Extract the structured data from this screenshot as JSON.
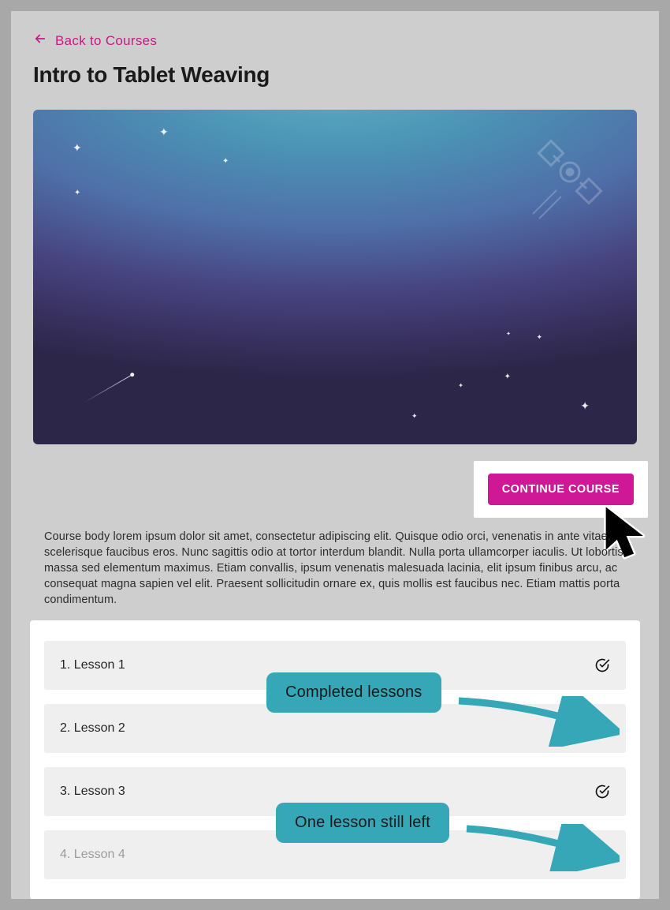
{
  "nav": {
    "back_label": "Back to Courses"
  },
  "course": {
    "title": "Intro to Tablet Weaving",
    "cta_label": "CONTINUE COURSE",
    "body": "Course body lorem ipsum dolor sit amet, consectetur adipiscing elit. Quisque odio orci, venenatis in ante vitae, scelerisque faucibus eros. Nunc sagittis odio at tortor interdum blandit. Nulla porta ullamcorper iaculis. Ut lobortis massa sed elementum maximus. Etiam convallis, ipsum venenatis malesuada lacinia, elit ipsum finibus arcu, ac consequat magna sapien vel elit. Praesent sollicitudin ornare ex, quis mollis est faucibus nec. Etiam mattis porta condimentum."
  },
  "lessons": [
    {
      "label": "1. Lesson 1",
      "completed": true
    },
    {
      "label": "2. Lesson 2",
      "completed": true
    },
    {
      "label": "3. Lesson 3",
      "completed": true
    },
    {
      "label": "4. Lesson 4",
      "completed": false
    }
  ],
  "annotations": {
    "completed": "Completed  lessons",
    "remaining": "One lesson still left"
  },
  "colors": {
    "accent": "#c41b85",
    "cta": "#cf1896",
    "annotation": "#35a7b7"
  }
}
